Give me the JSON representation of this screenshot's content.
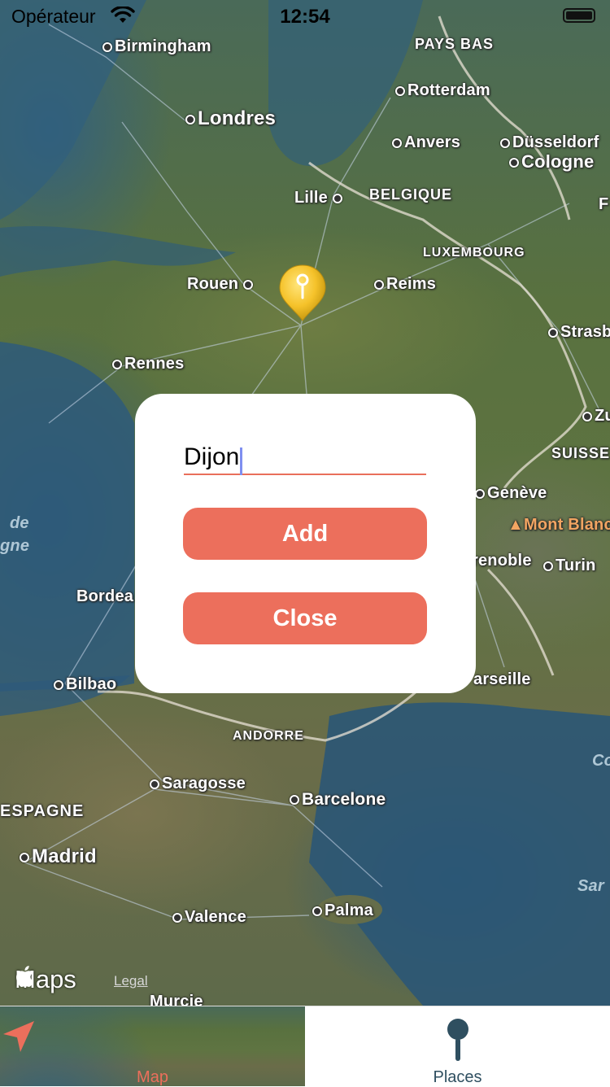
{
  "status_bar": {
    "carrier": "Opérateur",
    "time": "12:54",
    "battery_level": 1.0
  },
  "map": {
    "labels": {
      "birmingham": "Birmingham",
      "londres": "Londres",
      "pays_bas": "PAYS BAS",
      "rotterdam": "Rotterdam",
      "anvers": "Anvers",
      "dusseldorf": "Düsseldorf",
      "cologne": "Cologne",
      "lille": "Lille",
      "belgique": "BELGIQUE",
      "luxembourg": "LUXEMBOURG",
      "rouen": "Rouen",
      "reims": "Reims",
      "strasb": "Strasb",
      "rennes": "Rennes",
      "suisse": "SUISSE",
      "geneve": "Genève",
      "mont_blanc": "Mont Blanc",
      "grenoble": "renoble",
      "turin": "Turin",
      "bordeaux": "Bordea",
      "bilbao": "Bilbao",
      "marseille": "arseille",
      "andorre": "ANDORRE",
      "saragosse": "Saragosse",
      "barcelone": "Barcelone",
      "espagne": "ESPAGNE",
      "madrid": "Madrid",
      "valence": "Valence",
      "palma": "Palma",
      "murcie": "Murcie",
      "golfe_1": "de",
      "golfe_2": "gne",
      "zu": "Zu",
      "f_edge": "F",
      "co_edge": "Co",
      "sar_edge": "Sar"
    },
    "attribution": {
      "logo": "Maps",
      "legal": "Legal"
    }
  },
  "modal": {
    "input_value": "Dijon",
    "add_label": "Add",
    "close_label": "Close"
  },
  "tabbar": {
    "tabs": [
      {
        "label": "Map",
        "icon": "navigation-arrow-icon",
        "selected": true
      },
      {
        "label": "Places",
        "icon": "map-pin-icon",
        "selected": false
      }
    ],
    "accent": "#ec6f5c"
  }
}
